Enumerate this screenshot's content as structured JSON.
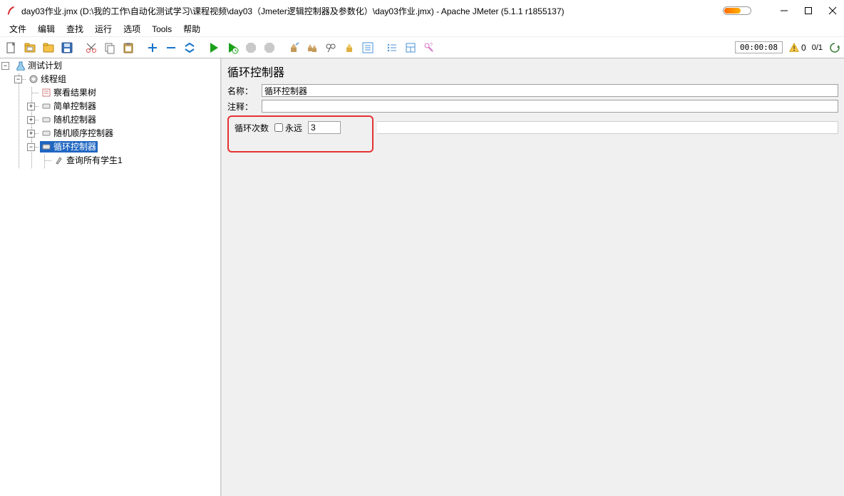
{
  "window": {
    "title": "day03作业.jmx (D:\\我的工作\\自动化测试学习\\课程视频\\day03（Jmeter逻辑控制器及参数化）\\day03作业.jmx) - Apache JMeter (5.1.1 r1855137)"
  },
  "menu": {
    "items": [
      "文件",
      "编辑",
      "查找",
      "运行",
      "选项",
      "Tools",
      "帮助"
    ]
  },
  "toolbar": {
    "buttons": [
      {
        "name": "new-file-icon",
        "tip": "new"
      },
      {
        "name": "folder-templates-icon",
        "tip": "templates"
      },
      {
        "name": "open-folder-icon",
        "tip": "open"
      },
      {
        "name": "save-icon",
        "tip": "save"
      },
      {
        "sep": true
      },
      {
        "name": "cut-icon",
        "tip": "cut"
      },
      {
        "name": "copy-icon",
        "tip": "copy"
      },
      {
        "name": "paste-icon",
        "tip": "paste"
      },
      {
        "sep": true
      },
      {
        "name": "expand-icon",
        "tip": "expand"
      },
      {
        "name": "collapse-icon",
        "tip": "collapse"
      },
      {
        "name": "toggle-icon",
        "tip": "toggle"
      },
      {
        "sep": true
      },
      {
        "name": "start-icon",
        "tip": "start",
        "color": "#1aa01a"
      },
      {
        "name": "start-no-timers-icon",
        "tip": "start-no-timers",
        "color": "#1aa01a"
      },
      {
        "name": "stop-icon",
        "tip": "stop",
        "disabled": true
      },
      {
        "name": "shutdown-icon",
        "tip": "shutdown",
        "disabled": true
      },
      {
        "sep": true
      },
      {
        "name": "clear-icon",
        "tip": "clear"
      },
      {
        "name": "clear-all-icon",
        "tip": "clear-all"
      },
      {
        "name": "search-icon",
        "tip": "search"
      },
      {
        "name": "reset-search-icon",
        "tip": "reset-search"
      },
      {
        "name": "function-helper-icon",
        "tip": "fn"
      },
      {
        "sep": true
      },
      {
        "name": "list-icon",
        "tip": "list"
      },
      {
        "name": "templates2-icon",
        "tip": "tpl"
      },
      {
        "name": "help-icon",
        "tip": "help"
      }
    ]
  },
  "statusbar": {
    "elapsed": "00:00:08",
    "warn_count": "0",
    "thread_count": "0/1"
  },
  "tree": {
    "root": {
      "label": "测试计划"
    },
    "thread_group": {
      "label": "线程组"
    },
    "nodes": [
      {
        "label": "察看结果树",
        "icon": "result-tree-icon"
      },
      {
        "label": "简单控制器",
        "icon": "controller-icon",
        "expandable": true
      },
      {
        "label": "随机控制器",
        "icon": "controller-icon",
        "expandable": true
      },
      {
        "label": "随机顺序控制器",
        "icon": "controller-icon",
        "expandable": true
      },
      {
        "label": "循环控制器",
        "icon": "controller-icon",
        "expandable": true,
        "selected": true
      },
      {
        "label": "查询所有学生1",
        "icon": "sampler-icon",
        "child_of_selected": true
      }
    ]
  },
  "content": {
    "panel_title": "循环控制器",
    "name_label": "名称：",
    "name_value": "循环控制器",
    "comment_label": "注释：",
    "comment_value": "",
    "loop_label": "循环次数",
    "forever_label": "永远",
    "forever_checked": false,
    "loop_count": "3"
  }
}
